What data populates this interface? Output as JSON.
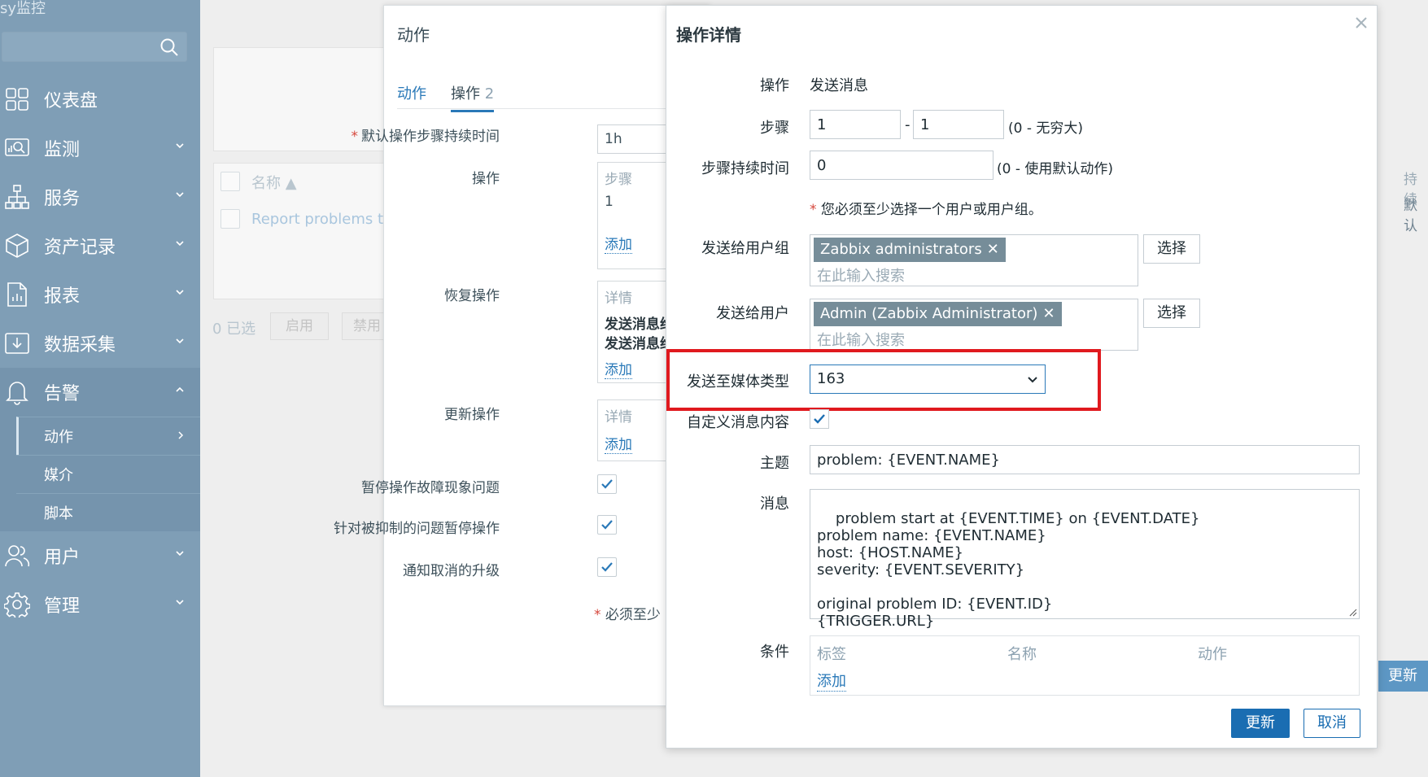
{
  "sidebar": {
    "brand": "sy监控",
    "search_placeholder": "",
    "items": [
      {
        "label": "仪表盘",
        "icon": "dashboard-icon"
      },
      {
        "label": "监测",
        "icon": "monitoring-icon"
      },
      {
        "label": "服务",
        "icon": "services-icon"
      },
      {
        "label": "资产记录",
        "icon": "inventory-icon"
      },
      {
        "label": "报表",
        "icon": "reports-icon"
      },
      {
        "label": "数据采集",
        "icon": "data-collection-icon"
      },
      {
        "label": "告警",
        "icon": "alerts-icon"
      },
      {
        "label": "用户",
        "icon": "users-icon"
      },
      {
        "label": "管理",
        "icon": "administration-icon"
      }
    ],
    "alerts_sub": [
      {
        "label": "动作"
      },
      {
        "label": "媒介"
      },
      {
        "label": "脚本"
      }
    ]
  },
  "background_page": {
    "name_header": "名称",
    "row_text": "Report problems to Z",
    "selected_count": "0 已选",
    "enable_button": "启用",
    "disable_button": "禁用",
    "right_header": "持续",
    "right_value": "默认",
    "right_button": "更新"
  },
  "action_dialog": {
    "title": "动作",
    "tab_action": "动作",
    "tab_operations": "操作",
    "tab_operations_count": "2",
    "default_duration_label": "默认操作步骤持续时间",
    "default_duration_value": "1h",
    "operations_label": "操作",
    "operations_col_steps": "步骤",
    "operations_row_step": "1",
    "add_link": "添加",
    "recovery_label": "恢复操作",
    "details_col": "详情",
    "recovery_row1": "发送消息给",
    "recovery_row2": "发送消息给",
    "update_label": "更新操作",
    "pause_symptoms_label": "暂停操作故障现象问题",
    "pause_suppressed_label": "针对被抑制的问题暂停操作",
    "notify_cancelled_label": "通知取消的升级",
    "must_note": "必须至少"
  },
  "operation_details": {
    "title": "操作详情",
    "operation_label": "操作",
    "operation_value": "发送消息",
    "steps_label": "步骤",
    "step_from": "1",
    "step_dash": "-",
    "step_to": "1",
    "steps_hint": "(0 - 无穷大)",
    "step_duration_label": "步骤持续时间",
    "step_duration_value": "0",
    "step_duration_hint": "(0 - 使用默认动作)",
    "warning": "您必须至少选择一个用户或用户组。",
    "send_groups_label": "发送给用户组",
    "group_tag": "Zabbix administrators",
    "search_placeholder": "在此输入搜索",
    "select_button": "选择",
    "send_users_label": "发送给用户",
    "user_tag": "Admin (Zabbix Administrator)",
    "media_type_label": "发送至媒体类型",
    "media_type_value": "163",
    "custom_message_label": "自定义消息内容",
    "custom_message_checked": true,
    "subject_label": "主题",
    "subject_value": "problem: {EVENT.NAME}",
    "message_label": "消息",
    "message_value": "problem start at {EVENT.TIME} on {EVENT.DATE}\nproblem name: {EVENT.NAME}\nhost: {HOST.NAME}\nseverity: {EVENT.SEVERITY}\n\noriginal problem ID: {EVENT.ID}\n{TRIGGER.URL}",
    "conditions_label": "条件",
    "cond_col_tag": "标签",
    "cond_col_name": "名称",
    "cond_col_action": "动作",
    "cond_add": "添加",
    "update_button": "更新",
    "cancel_button": "取消"
  },
  "colors": {
    "sidebar_bg": "#7f9eb6",
    "accent": "#1a6db2",
    "highlight_border": "#e0191e",
    "tag_bg": "#768d99"
  }
}
